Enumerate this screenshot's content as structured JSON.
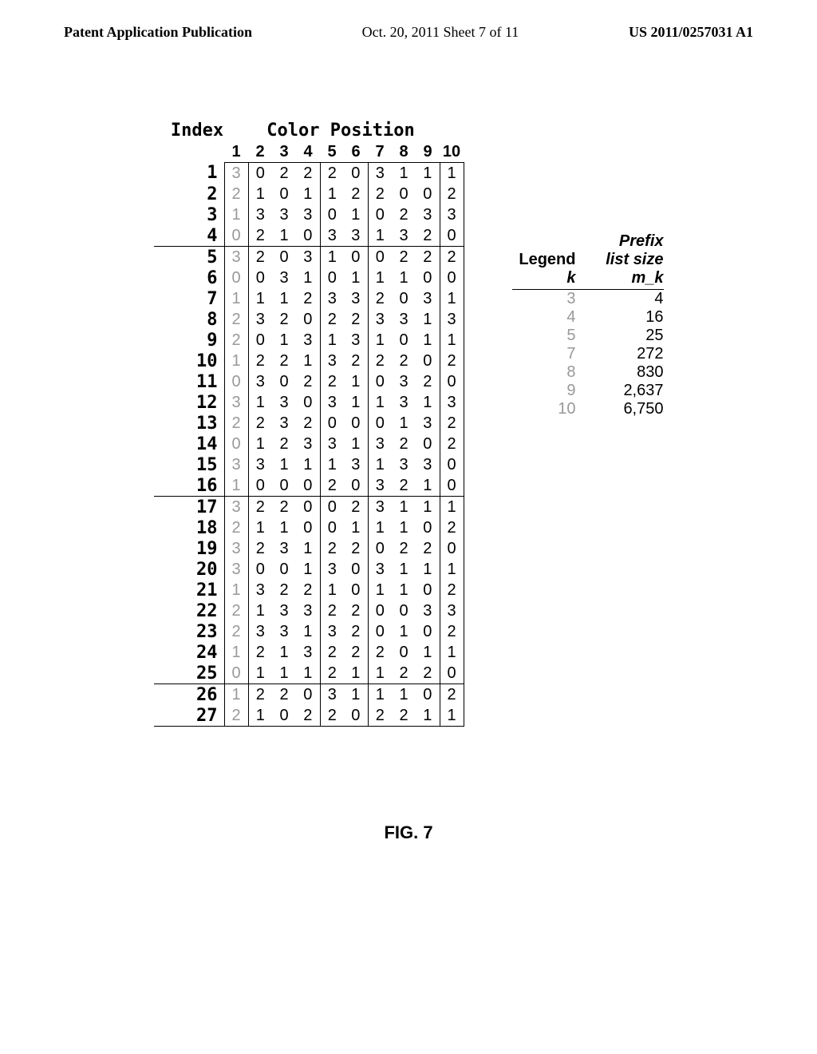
{
  "header": {
    "left": "Patent Application Publication",
    "center": "Oct. 20, 2011  Sheet 7 of 11",
    "right": "US 2011/0257031 A1"
  },
  "table": {
    "index_label": "Index",
    "color_position_label": "Color Position",
    "col_headers": [
      "1",
      "2",
      "3",
      "4",
      "5",
      "6",
      "7",
      "8",
      "9",
      "10"
    ],
    "rows": [
      {
        "idx": "1",
        "cells": [
          "3",
          "0",
          "2",
          "2",
          "2",
          "0",
          "3",
          "1",
          "1",
          "1"
        ]
      },
      {
        "idx": "2",
        "cells": [
          "2",
          "1",
          "0",
          "1",
          "1",
          "2",
          "2",
          "0",
          "0",
          "2"
        ]
      },
      {
        "idx": "3",
        "cells": [
          "1",
          "3",
          "3",
          "3",
          "0",
          "1",
          "0",
          "2",
          "3",
          "3"
        ]
      },
      {
        "idx": "4",
        "cells": [
          "0",
          "2",
          "1",
          "0",
          "3",
          "3",
          "1",
          "3",
          "2",
          "0"
        ]
      },
      {
        "idx": "5",
        "cells": [
          "3",
          "2",
          "0",
          "3",
          "1",
          "0",
          "0",
          "2",
          "2",
          "2"
        ]
      },
      {
        "idx": "6",
        "cells": [
          "0",
          "0",
          "3",
          "1",
          "0",
          "1",
          "1",
          "1",
          "0",
          "0"
        ]
      },
      {
        "idx": "7",
        "cells": [
          "1",
          "1",
          "1",
          "2",
          "3",
          "3",
          "2",
          "0",
          "3",
          "1"
        ]
      },
      {
        "idx": "8",
        "cells": [
          "2",
          "3",
          "2",
          "0",
          "2",
          "2",
          "3",
          "3",
          "1",
          "3"
        ]
      },
      {
        "idx": "9",
        "cells": [
          "2",
          "0",
          "1",
          "3",
          "1",
          "3",
          "1",
          "0",
          "1",
          "1"
        ]
      },
      {
        "idx": "10",
        "cells": [
          "1",
          "2",
          "2",
          "1",
          "3",
          "2",
          "2",
          "2",
          "0",
          "2"
        ]
      },
      {
        "idx": "11",
        "cells": [
          "0",
          "3",
          "0",
          "2",
          "2",
          "1",
          "0",
          "3",
          "2",
          "0"
        ]
      },
      {
        "idx": "12",
        "cells": [
          "3",
          "1",
          "3",
          "0",
          "3",
          "1",
          "1",
          "3",
          "1",
          "3"
        ]
      },
      {
        "idx": "13",
        "cells": [
          "2",
          "2",
          "3",
          "2",
          "0",
          "0",
          "0",
          "1",
          "3",
          "2"
        ]
      },
      {
        "idx": "14",
        "cells": [
          "0",
          "1",
          "2",
          "3",
          "3",
          "1",
          "3",
          "2",
          "0",
          "2"
        ]
      },
      {
        "idx": "15",
        "cells": [
          "3",
          "3",
          "1",
          "1",
          "1",
          "3",
          "1",
          "3",
          "3",
          "0"
        ]
      },
      {
        "idx": "16",
        "cells": [
          "1",
          "0",
          "0",
          "0",
          "2",
          "0",
          "3",
          "2",
          "1",
          "0"
        ]
      },
      {
        "idx": "17",
        "cells": [
          "3",
          "2",
          "2",
          "0",
          "0",
          "2",
          "3",
          "1",
          "1",
          "1"
        ]
      },
      {
        "idx": "18",
        "cells": [
          "2",
          "1",
          "1",
          "0",
          "0",
          "1",
          "1",
          "1",
          "0",
          "2"
        ]
      },
      {
        "idx": "19",
        "cells": [
          "3",
          "2",
          "3",
          "1",
          "2",
          "2",
          "0",
          "2",
          "2",
          "0"
        ]
      },
      {
        "idx": "20",
        "cells": [
          "3",
          "0",
          "0",
          "1",
          "3",
          "0",
          "3",
          "1",
          "1",
          "1"
        ]
      },
      {
        "idx": "21",
        "cells": [
          "1",
          "3",
          "2",
          "2",
          "1",
          "0",
          "1",
          "1",
          "0",
          "2"
        ]
      },
      {
        "idx": "22",
        "cells": [
          "2",
          "1",
          "3",
          "3",
          "2",
          "2",
          "0",
          "0",
          "3",
          "3"
        ]
      },
      {
        "idx": "23",
        "cells": [
          "2",
          "3",
          "3",
          "1",
          "3",
          "2",
          "0",
          "1",
          "0",
          "2"
        ]
      },
      {
        "idx": "24",
        "cells": [
          "1",
          "2",
          "1",
          "3",
          "2",
          "2",
          "2",
          "0",
          "1",
          "1"
        ]
      },
      {
        "idx": "25",
        "cells": [
          "0",
          "1",
          "1",
          "1",
          "2",
          "1",
          "1",
          "2",
          "2",
          "0"
        ]
      },
      {
        "idx": "26",
        "cells": [
          "1",
          "2",
          "2",
          "0",
          "3",
          "1",
          "1",
          "1",
          "0",
          "2"
        ]
      },
      {
        "idx": "27",
        "cells": [
          "2",
          "1",
          "0",
          "2",
          "2",
          "0",
          "2",
          "2",
          "1",
          "1"
        ]
      }
    ]
  },
  "legend": {
    "title": "Legend",
    "prefix_label": "Prefix",
    "list_size_label": "list size",
    "k_label": "k",
    "mk_label": "m_k",
    "rows": [
      {
        "k": "3",
        "mk": "4"
      },
      {
        "k": "4",
        "mk": "16"
      },
      {
        "k": "5",
        "mk": "25"
      },
      {
        "k": "7",
        "mk": "272"
      },
      {
        "k": "8",
        "mk": "830"
      },
      {
        "k": "9",
        "mk": "2,637"
      },
      {
        "k": "10",
        "mk": "6,750"
      }
    ]
  },
  "figure_label": "FIG. 7"
}
